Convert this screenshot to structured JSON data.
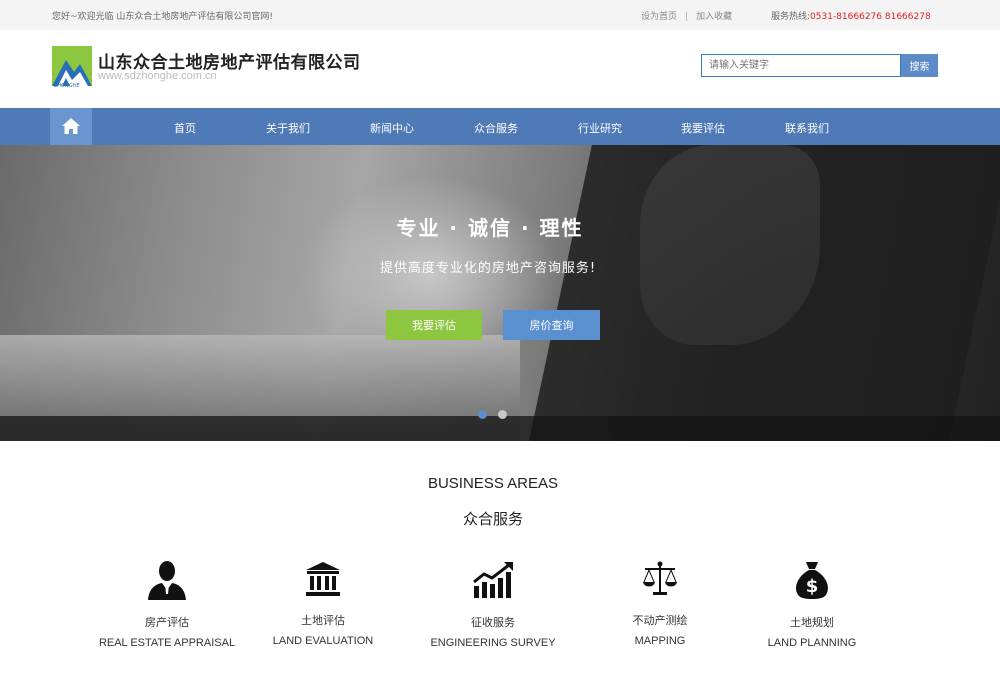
{
  "topbar": {
    "welcome": "您好~欢迎光临 山东众合土地房地产评估有限公司官网!",
    "set_home": "设为首页",
    "separator": "|",
    "add_favorite": "加入收藏",
    "hotline_label": "服务热线:",
    "hotline_number": "0531-81666276 81666278",
    "accent_color": "#e02020"
  },
  "header": {
    "logo_text": "ZHONGHE",
    "company_name": "山东众合土地房地产评估有限公司",
    "domain": "www.sdzhonghe.com.cn"
  },
  "search": {
    "placeholder": "请输入关键字",
    "button_label": "搜索"
  },
  "nav": {
    "home_icon": "home-icon",
    "items": [
      "首页",
      "关于我们",
      "新闻中心",
      "众合服务",
      "行业研究",
      "我要评估",
      "联系我们"
    ],
    "bar_color": "#4f7ab8"
  },
  "hero": {
    "headline": "专业 · 诚信 · 理性",
    "tagline": "提供高度专业化的房地产咨询服务!",
    "primary_button": "我要评估",
    "secondary_button": "房价查询",
    "primary_color": "#8dc63f",
    "secondary_color": "#5a8fd0"
  },
  "business": {
    "title_en": "BUSINESS AREAS",
    "title_cn": "众合服务",
    "items": [
      {
        "cn": "房产评估",
        "en": "REAL ESTATE APPRAISAL",
        "icon": "person-icon"
      },
      {
        "cn": "土地评估",
        "en": "LAND EVALUATION",
        "icon": "bank-icon"
      },
      {
        "cn": "征收服务",
        "en": "ENGINEERING SURVEY",
        "icon": "growth-chart-icon"
      },
      {
        "cn": "不动产测绘",
        "en": "MAPPING",
        "icon": "scales-icon"
      },
      {
        "cn": "土地规划",
        "en": "LAND PLANNING",
        "icon": "money-bag-icon"
      }
    ]
  }
}
